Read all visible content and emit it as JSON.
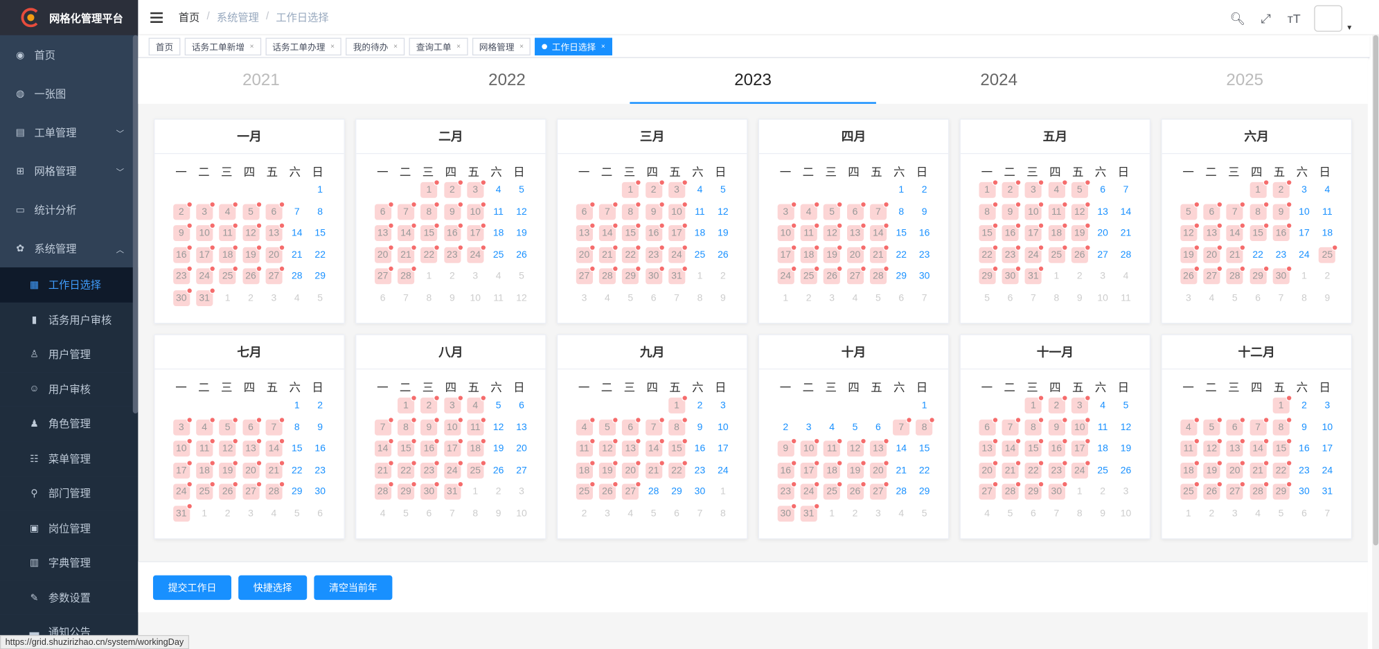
{
  "app": {
    "title": "网格化管理平台"
  },
  "sidebar": {
    "items": [
      {
        "label": "首页",
        "icon": "dashboard-icon",
        "type": "top"
      },
      {
        "label": "一张图",
        "icon": "globe-icon",
        "type": "top"
      },
      {
        "label": "工单管理",
        "icon": "ticket-icon",
        "type": "top",
        "arrow": "﹀"
      },
      {
        "label": "网格管理",
        "icon": "grid-icon",
        "type": "top",
        "arrow": "﹀"
      },
      {
        "label": "统计分析",
        "icon": "monitor-icon",
        "type": "top"
      },
      {
        "label": "系统管理",
        "icon": "gear-icon",
        "type": "top",
        "arrow": "︿"
      },
      {
        "label": "工作日选择",
        "icon": "calendar-icon",
        "type": "sub",
        "active": true
      },
      {
        "label": "话务用户审核",
        "icon": "bar-chart-icon",
        "type": "sub"
      },
      {
        "label": "用户管理",
        "icon": "user-icon",
        "type": "sub"
      },
      {
        "label": "用户审核",
        "icon": "peoples-icon",
        "type": "sub"
      },
      {
        "label": "角色管理",
        "icon": "role-icon",
        "type": "sub"
      },
      {
        "label": "菜单管理",
        "icon": "tree-table-icon",
        "type": "sub"
      },
      {
        "label": "部门管理",
        "icon": "tree-icon",
        "type": "sub"
      },
      {
        "label": "岗位管理",
        "icon": "post-icon",
        "type": "sub"
      },
      {
        "label": "字典管理",
        "icon": "dict-icon",
        "type": "sub"
      },
      {
        "label": "参数设置",
        "icon": "edit-icon",
        "type": "sub"
      },
      {
        "label": "通知公告",
        "icon": "message-icon",
        "type": "sub"
      }
    ]
  },
  "breadcrumb": {
    "home": "首页",
    "section": "系统管理",
    "page": "工作日选择",
    "sep": "/"
  },
  "tags": [
    {
      "label": "首页",
      "closable": false
    },
    {
      "label": "话务工单新增",
      "closable": true
    },
    {
      "label": "话务工单办理",
      "closable": true
    },
    {
      "label": "我的待办",
      "closable": true
    },
    {
      "label": "查询工单",
      "closable": true
    },
    {
      "label": "网格管理",
      "closable": true
    },
    {
      "label": "工作日选择",
      "closable": true,
      "active": true
    }
  ],
  "years": [
    {
      "label": "2021",
      "faded": true
    },
    {
      "label": "2022"
    },
    {
      "label": "2023",
      "active": true
    },
    {
      "label": "2024"
    },
    {
      "label": "2025",
      "faded": true
    }
  ],
  "weekdays": [
    "一",
    "二",
    "三",
    "四",
    "五",
    "六",
    "日"
  ],
  "calendar": {
    "year": 2023,
    "month_names": [
      "一月",
      "二月",
      "三月",
      "四月",
      "五月",
      "六月",
      "七月",
      "八月",
      "九月",
      "十月",
      "十一月",
      "十二月"
    ],
    "rest_days": [
      [
        2,
        3,
        4,
        5,
        6,
        9,
        10,
        11,
        12,
        13,
        16,
        17,
        18,
        19,
        20,
        23,
        24,
        25,
        26,
        27,
        30,
        31
      ],
      [
        1,
        2,
        3,
        6,
        7,
        8,
        9,
        10,
        13,
        14,
        15,
        16,
        17,
        20,
        21,
        22,
        23,
        24,
        27,
        28
      ],
      [
        1,
        2,
        3,
        6,
        7,
        8,
        9,
        10,
        13,
        14,
        15,
        16,
        17,
        20,
        21,
        22,
        23,
        24,
        27,
        28,
        29,
        30,
        31
      ],
      [
        3,
        4,
        5,
        6,
        7,
        10,
        11,
        12,
        13,
        14,
        17,
        18,
        19,
        20,
        21,
        24,
        25,
        26,
        27,
        28
      ],
      [
        1,
        2,
        3,
        4,
        5,
        8,
        9,
        10,
        11,
        12,
        15,
        16,
        17,
        18,
        19,
        22,
        23,
        24,
        25,
        26,
        29,
        30,
        31
      ],
      [
        1,
        2,
        5,
        6,
        7,
        8,
        9,
        12,
        13,
        14,
        15,
        16,
        19,
        20,
        21,
        25,
        26,
        27,
        28,
        29,
        30
      ],
      [
        3,
        4,
        5,
        6,
        7,
        10,
        11,
        12,
        13,
        14,
        17,
        18,
        19,
        20,
        21,
        24,
        25,
        26,
        27,
        28,
        31
      ],
      [
        1,
        2,
        3,
        4,
        7,
        8,
        9,
        10,
        11,
        14,
        15,
        16,
        17,
        18,
        21,
        22,
        23,
        24,
        25,
        28,
        29,
        30,
        31
      ],
      [
        1,
        4,
        5,
        6,
        7,
        8,
        11,
        12,
        13,
        14,
        15,
        18,
        19,
        20,
        21,
        22,
        25,
        26,
        27
      ],
      [
        7,
        8,
        9,
        10,
        11,
        12,
        13,
        16,
        17,
        18,
        19,
        20,
        23,
        24,
        25,
        26,
        27,
        30,
        31
      ],
      [
        1,
        2,
        3,
        6,
        7,
        8,
        9,
        10,
        13,
        14,
        15,
        16,
        17,
        20,
        21,
        22,
        23,
        24,
        27,
        28,
        29,
        30
      ],
      [
        1,
        4,
        5,
        6,
        7,
        8,
        11,
        12,
        13,
        14,
        15,
        18,
        19,
        20,
        21,
        22,
        25,
        26,
        27,
        28,
        29
      ]
    ]
  },
  "actions": {
    "submit": "提交工作日",
    "quick": "快捷选择",
    "clear": "清空当前年"
  },
  "status_url": "https://grid.shuzirizhao.cn/system/workingDay",
  "colors": {
    "sidebar": "#304156",
    "accent": "#1890ff",
    "rest_bg": "#fcd5d5",
    "rest_dot": "#f56c6c"
  }
}
